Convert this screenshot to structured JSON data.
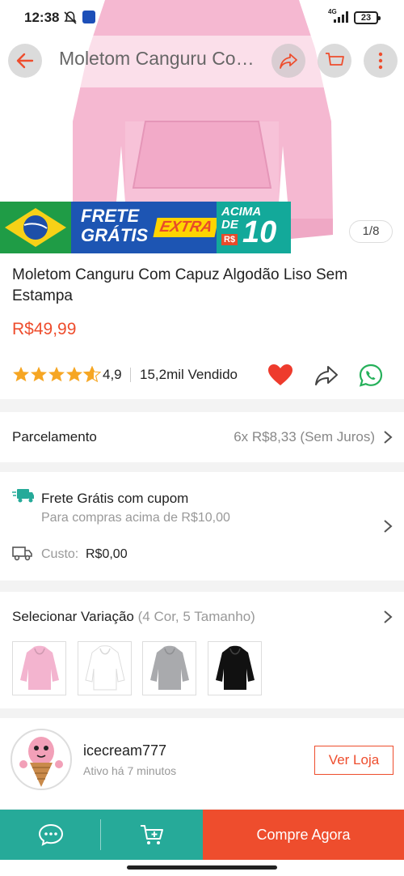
{
  "status_bar": {
    "time": "12:38",
    "network": "4G",
    "battery": "23"
  },
  "nav": {
    "title": "Moletom Canguru Com Capuz Algodão Liso Sem Estampa"
  },
  "banner": {
    "line1": "FRETE",
    "line2": "GRÁTIS",
    "extra": "EXTRA",
    "acima": "ACIMA",
    "de": "DE",
    "currency": "R$",
    "amount": "10"
  },
  "gallery": {
    "page_count": "1/8"
  },
  "product": {
    "title": "Moletom Canguru Com Capuz Algodão Liso Sem Estampa",
    "price": "R$49,99",
    "rating": "4,9",
    "sold": "15,2mil Vendido",
    "rating_stars": 4.9
  },
  "installments": {
    "label": "Parcelamento",
    "value": "6x R$8,33 (Sem Juros)"
  },
  "shipping": {
    "title": "Frete Grátis com cupom",
    "subtitle": "Para compras acima de R$10,00",
    "cost_label": "Custo:",
    "cost_value": "R$0,00"
  },
  "variants": {
    "label": "Selecionar Variação",
    "summary": "(4 Cor, 5 Tamanho)",
    "colors": [
      "#f3b4cf",
      "#ffffff",
      "#a9aaad",
      "#111111"
    ]
  },
  "seller": {
    "name": "icecream777",
    "active": "Ativo há 7 minutos",
    "button": "Ver Loja"
  },
  "bottom_bar": {
    "buy_now": "Compre Agora"
  },
  "colors": {
    "accent": "#ee4d2d",
    "teal": "#26aa99",
    "star": "#f6a623"
  }
}
